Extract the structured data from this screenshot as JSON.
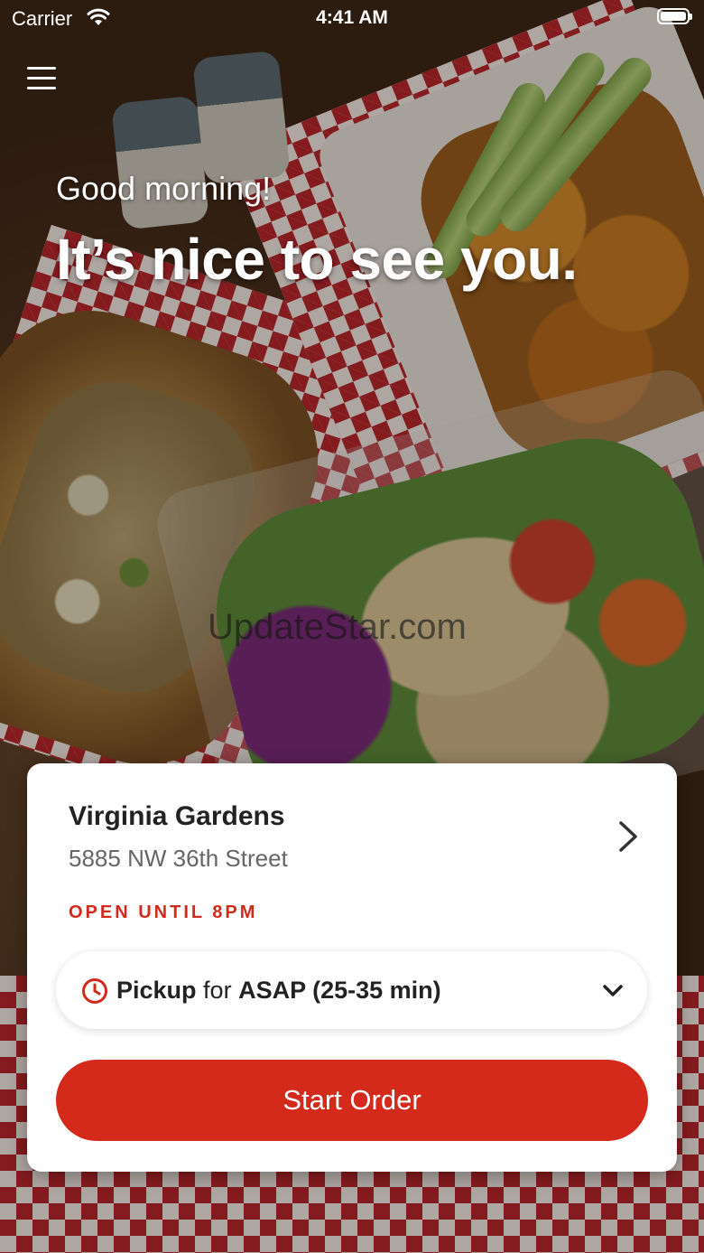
{
  "status_bar": {
    "carrier": "Carrier",
    "time": "4:41 AM"
  },
  "hero": {
    "greeting": "Good morning!",
    "headline": "It’s nice to see you."
  },
  "watermark": "UpdateStar.com",
  "location": {
    "name": "Virginia Gardens",
    "address": "5885 NW 36th Street",
    "status": "OPEN UNTIL 8PM"
  },
  "order_mode": {
    "mode": "Pickup",
    "connector": "for",
    "time": "ASAP (25-35 min)"
  },
  "actions": {
    "start_order": "Start Order"
  },
  "colors": {
    "accent": "#d42a1c",
    "card_bg": "#ffffff"
  },
  "icons": {
    "menu": "hamburger-menu-icon",
    "location_chevron": "chevron-right-icon",
    "pickup_clock": "clock-icon",
    "pickup_dropdown": "chevron-down-icon",
    "wifi": "wifi-icon",
    "battery": "battery-icon"
  }
}
